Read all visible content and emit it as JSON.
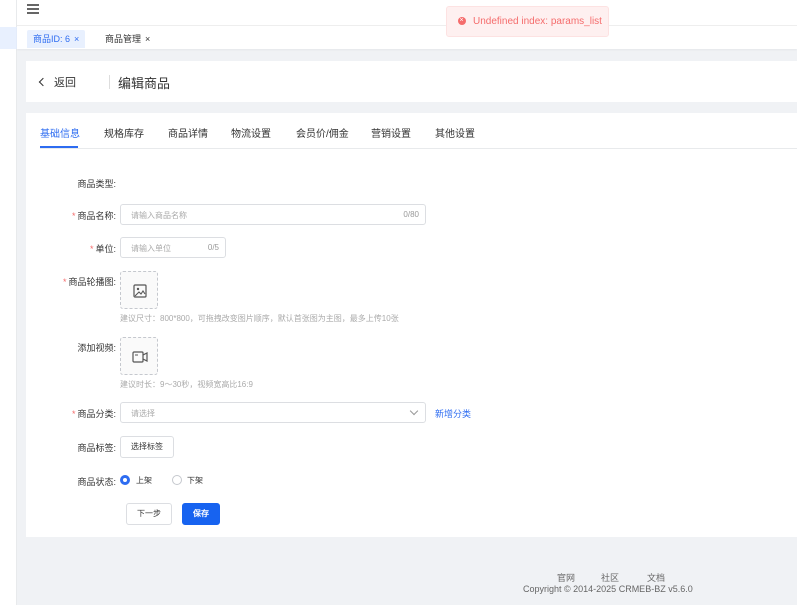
{
  "tabs": [
    {
      "label": "商品ID: 6",
      "close": "×",
      "active": true
    },
    {
      "label": "商品管理",
      "close": "×",
      "active": false
    }
  ],
  "toast": {
    "message": "Undefined index: params_list"
  },
  "header": {
    "back_label": "返回",
    "title": "编辑商品"
  },
  "product_tabs": [
    "基础信息",
    "规格库存",
    "商品详情",
    "物流设置",
    "会员价/佣金",
    "营销设置",
    "其他设置"
  ],
  "form": {
    "type_label": "商品类型:",
    "name": {
      "required": "*",
      "label": "商品名称:",
      "placeholder": "请输入商品名称",
      "count": "0/80"
    },
    "unit": {
      "required": "*",
      "label": "单位:",
      "placeholder": "请输入单位",
      "count": "0/5"
    },
    "carousel": {
      "required": "*",
      "label": "商品轮播图:",
      "hint": "建议尺寸：800*800，可拖拽改变图片顺序，默认首张图为主图，最多上传10张"
    },
    "video": {
      "label": "添加视频:",
      "hint": "建议时长：9～30秒，视频宽高比16:9"
    },
    "category": {
      "required": "*",
      "label": "商品分类:",
      "placeholder": "请选择",
      "add_link": "新增分类"
    },
    "tags": {
      "label": "商品标签:",
      "button": "选择标签"
    },
    "status": {
      "label": "商品状态:",
      "options": [
        "上架",
        "下架"
      ],
      "selected": "上架"
    },
    "next_button": "下一步",
    "save_button": "保存"
  },
  "footer": {
    "links": [
      "官网",
      "社区",
      "文档"
    ],
    "copyright": "Copyright © 2014-2025 CRMEB-BZ v5.6.0"
  },
  "colors": {
    "primary": "#2d6cf1",
    "error": "#f56c6c"
  }
}
